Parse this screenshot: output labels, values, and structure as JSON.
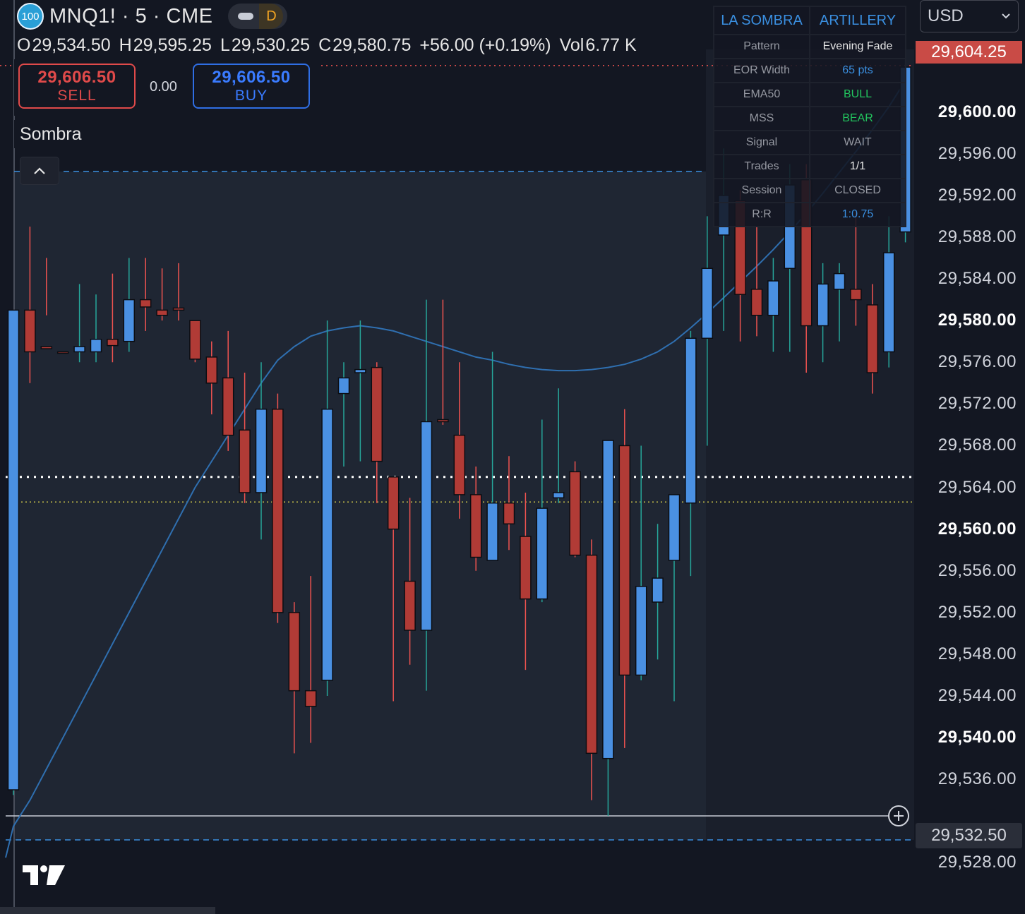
{
  "header": {
    "badge": "100",
    "symbol_title": "MNQ1! · 5 · CME",
    "delay_letter": "D"
  },
  "ohlc": {
    "o_label": "O",
    "o": "29,534.50",
    "h_label": "H",
    "h": "29,595.25",
    "l_label": "L",
    "l": "29,530.25",
    "c_label": "C",
    "c": "29,580.75",
    "change": "+56.00 (+0.19%)",
    "vol_label": "Vol",
    "vol": "6.77 K"
  },
  "trade": {
    "sell_price": "29,606.50",
    "sell_label": "SELL",
    "spread": "0.00",
    "buy_price": "29,606.50",
    "buy_label": "BUY"
  },
  "indicator": {
    "name": "Sombra"
  },
  "info_table": {
    "header": [
      "LA SOMBRA",
      "ARTILLERY"
    ],
    "rows": [
      {
        "key": "Pattern",
        "value": "Evening Fade",
        "color": "#e6e6e6"
      },
      {
        "key": "EOR Width",
        "value": "65 pts",
        "color": "#3a8fe0"
      },
      {
        "key": "EMA50",
        "value": "BULL",
        "color": "#22c55e"
      },
      {
        "key": "MSS",
        "value": "BEAR",
        "color": "#22c55e"
      },
      {
        "key": "Signal",
        "value": "WAIT",
        "color": "#9598a1"
      },
      {
        "key": "Trades",
        "value": "1/1",
        "color": "#e6e6e6"
      },
      {
        "key": "Session",
        "value": "CLOSED",
        "color": "#9598a1"
      },
      {
        "key": "R:R",
        "value": "1:0.75",
        "color": "#3a8fe0"
      }
    ]
  },
  "price_axis": {
    "currency": "USD",
    "ticks": [
      "29,600.00",
      "29,596.00",
      "29,592.00",
      "29,588.00",
      "29,584.00",
      "29,580.00",
      "29,576.00",
      "29,572.00",
      "29,568.00",
      "29,564.00",
      "29,560.00",
      "29,556.00",
      "29,552.00",
      "29,548.00",
      "29,544.00",
      "29,540.00",
      "29,536.00",
      "29,528.00"
    ],
    "tick_values": [
      29600,
      29596,
      29592,
      29588,
      29584,
      29580,
      29576,
      29572,
      29568,
      29564,
      29560,
      29556,
      29552,
      29548,
      29544,
      29540,
      29536,
      29528
    ],
    "bold_ticks": [
      29600,
      29580,
      29560,
      29540
    ],
    "last_price": "29,604.25",
    "crosshair_price": "29,532.50"
  },
  "colors": {
    "up": "#4a90e2",
    "down": "#b13b36",
    "up_wick": "#26a69a",
    "down_wick": "#ef5350",
    "ema": "#2f6fb0",
    "background": "#131722"
  },
  "chart_data": {
    "type": "candlestick",
    "symbol": "MNQ1!",
    "interval": "5",
    "ylim": [
      29526,
      29606
    ],
    "levels": {
      "last_price": 29604.25,
      "crosshair": 29532.5,
      "white_dotted": 29565.0,
      "yellow_dotted": 29562.6,
      "blue_dashed_top": 29594.3,
      "blue_dashed_bottom": 29530.2
    },
    "candles": [
      {
        "o": 29535.0,
        "h": 29581.0,
        "l": 29534.5,
        "c": 29581.0
      },
      {
        "o": 29581.0,
        "h": 29589.0,
        "l": 29574.0,
        "c": 29577.0
      },
      {
        "o": 29577.5,
        "h": 29586.0,
        "l": 29580.5,
        "c": 29577.3
      },
      {
        "o": 29577.0,
        "h": 29577.0,
        "l": 29576.9,
        "c": 29576.9
      },
      {
        "o": 29577.0,
        "h": 29583.5,
        "l": 29576.0,
        "c": 29577.5
      },
      {
        "o": 29577.0,
        "h": 29582.5,
        "l": 29576.0,
        "c": 29578.2
      },
      {
        "o": 29578.2,
        "h": 29584.5,
        "l": 29576.0,
        "c": 29577.6
      },
      {
        "o": 29578.0,
        "h": 29586.0,
        "l": 29577.0,
        "c": 29582.0
      },
      {
        "o": 29582.0,
        "h": 29586.0,
        "l": 29579.0,
        "c": 29581.3
      },
      {
        "o": 29581.0,
        "h": 29585.0,
        "l": 29580.0,
        "c": 29580.5
      },
      {
        "o": 29581.2,
        "h": 29585.5,
        "l": 29580.0,
        "c": 29581.0
      },
      {
        "o": 29580.0,
        "h": 29580.0,
        "l": 29576.0,
        "c": 29576.3
      },
      {
        "o": 29576.5,
        "h": 29578.0,
        "l": 29571.0,
        "c": 29574.0
      },
      {
        "o": 29574.5,
        "h": 29579.0,
        "l": 29567.5,
        "c": 29569.0
      },
      {
        "o": 29569.5,
        "h": 29575.0,
        "l": 29562.5,
        "c": 29563.5
      },
      {
        "o": 29563.5,
        "h": 29576.0,
        "l": 29559.0,
        "c": 29571.5
      },
      {
        "o": 29571.5,
        "h": 29573.0,
        "l": 29551.0,
        "c": 29552.0
      },
      {
        "o": 29552.0,
        "h": 29553.0,
        "l": 29538.5,
        "c": 29544.5
      },
      {
        "o": 29544.5,
        "h": 29555.5,
        "l": 29539.5,
        "c": 29543.0
      },
      {
        "o": 29545.5,
        "h": 29580.0,
        "l": 29544.0,
        "c": 29571.5
      },
      {
        "o": 29573.0,
        "h": 29576.0,
        "l": 29566.0,
        "c": 29574.5
      },
      {
        "o": 29575.0,
        "h": 29580.0,
        "l": 29566.5,
        "c": 29575.3
      },
      {
        "o": 29575.5,
        "h": 29576.0,
        "l": 29562.5,
        "c": 29566.5
      },
      {
        "o": 29565.0,
        "h": 29565.0,
        "l": 29543.5,
        "c": 29560.0
      },
      {
        "o": 29555.0,
        "h": 29563.0,
        "l": 29547.0,
        "c": 29550.3
      },
      {
        "o": 29550.3,
        "h": 29582.0,
        "l": 29544.5,
        "c": 29570.3
      },
      {
        "o": 29570.5,
        "h": 29582.0,
        "l": 29570.0,
        "c": 29570.3
      },
      {
        "o": 29569.0,
        "h": 29576.0,
        "l": 29561.0,
        "c": 29563.3
      },
      {
        "o": 29563.3,
        "h": 29566.0,
        "l": 29556.0,
        "c": 29557.3
      },
      {
        "o": 29557.0,
        "h": 29577.0,
        "l": 29557.0,
        "c": 29562.5
      },
      {
        "o": 29562.5,
        "h": 29567.0,
        "l": 29558.0,
        "c": 29560.5
      },
      {
        "o": 29559.3,
        "h": 29563.5,
        "l": 29546.5,
        "c": 29553.3
      },
      {
        "o": 29553.3,
        "h": 29570.5,
        "l": 29553.0,
        "c": 29562.0
      },
      {
        "o": 29563.0,
        "h": 29573.5,
        "l": 29562.5,
        "c": 29563.5
      },
      {
        "o": 29565.5,
        "h": 29566.5,
        "l": 29557.3,
        "c": 29557.5
      },
      {
        "o": 29557.5,
        "h": 29559.0,
        "l": 29534.0,
        "c": 29538.5
      },
      {
        "o": 29538.0,
        "h": 29568.5,
        "l": 29532.5,
        "c": 29568.5
      },
      {
        "o": 29568.0,
        "h": 29571.5,
        "l": 29539.0,
        "c": 29546.0
      },
      {
        "o": 29546.0,
        "h": 29568.0,
        "l": 29545.5,
        "c": 29554.5
      },
      {
        "o": 29553.0,
        "h": 29560.5,
        "l": 29547.5,
        "c": 29555.3
      },
      {
        "o": 29557.0,
        "h": 29562.0,
        "l": 29543.5,
        "c": 29563.3
      },
      {
        "o": 29562.5,
        "h": 29579.0,
        "l": 29555.5,
        "c": 29578.3
      },
      {
        "o": 29578.3,
        "h": 29590.0,
        "l": 29568.0,
        "c": 29585.0
      },
      {
        "o": 29588.2,
        "h": 29596.5,
        "l": 29579.0,
        "c": 29592.0
      },
      {
        "o": 29591.5,
        "h": 29592.5,
        "l": 29578.0,
        "c": 29582.5
      },
      {
        "o": 29583.0,
        "h": 29589.0,
        "l": 29578.5,
        "c": 29580.5
      },
      {
        "o": 29580.5,
        "h": 29586.0,
        "l": 29577.0,
        "c": 29583.8
      },
      {
        "o": 29585.0,
        "h": 29595.0,
        "l": 29577.0,
        "c": 29593.0
      },
      {
        "o": 29593.5,
        "h": 29595.0,
        "l": 29575.0,
        "c": 29579.5
      },
      {
        "o": 29579.5,
        "h": 29585.5,
        "l": 29576.0,
        "c": 29583.5
      },
      {
        "o": 29583.0,
        "h": 29585.5,
        "l": 29578.0,
        "c": 29584.5
      },
      {
        "o": 29583.0,
        "h": 29590.5,
        "l": 29579.5,
        "c": 29582.0
      },
      {
        "o": 29581.5,
        "h": 29583.5,
        "l": 29573.0,
        "c": 29575.0
      },
      {
        "o": 29577.0,
        "h": 29590.0,
        "l": 29575.5,
        "c": 29586.5
      },
      {
        "o": 29588.5,
        "h": 29605.0,
        "l": 29587.5,
        "c": 29604.3
      }
    ],
    "ema50": [
      29531.5,
      29534,
      29537,
      29540,
      29543,
      29546,
      29549,
      29552,
      29555,
      29558,
      29561,
      29564,
      29566.5,
      29569,
      29571.5,
      29574,
      29576.2,
      29577.5,
      29578.5,
      29579,
      29579.3,
      29579.5,
      29579.3,
      29579,
      29578.5,
      29578,
      29577.5,
      29577,
      29576.5,
      29576.2,
      29575.8,
      29575.5,
      29575.3,
      29575.2,
      29575.2,
      29575.3,
      29575.5,
      29575.8,
      29576.3,
      29577,
      29578,
      29579.3,
      29580.7,
      29582.2,
      29583.7,
      29585.2,
      29586.8,
      29588.5,
      29590.3,
      29592.2,
      29594.2,
      29596.2,
      29598.3,
      29600.5,
      29603
    ]
  }
}
